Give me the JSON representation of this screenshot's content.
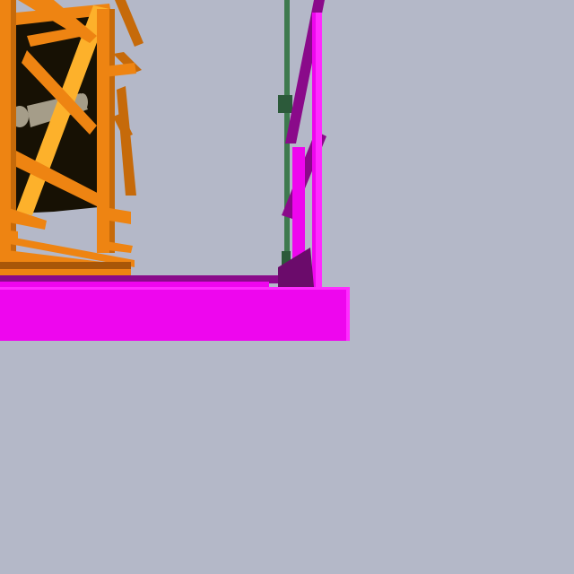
{
  "scene": {
    "background": "#b4b8c8",
    "colors": {
      "orange_light": "#fdb12b",
      "orange": "#ee8412",
      "orange_dark": "#c66a0a",
      "orange_shadow": "#a85608",
      "dark_interior": "#171104",
      "machine_grey": "#a59d89",
      "magenta": "#ee06ee",
      "magenta_light": "#ff2cff",
      "purple_dark": "#8a0a8a",
      "purple_deep": "#6b0b6b",
      "green_pole": "#3e7a4e",
      "green_dark": "#2c5a3a"
    }
  }
}
